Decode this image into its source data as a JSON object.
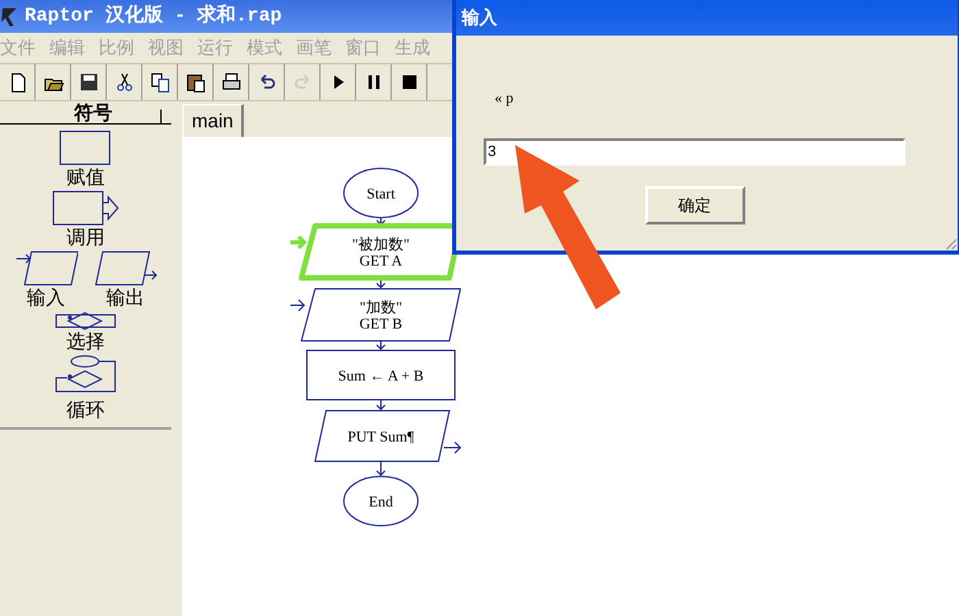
{
  "window": {
    "title": "Raptor 汉化版 - 求和.rap"
  },
  "menu": [
    "文件",
    "编辑",
    "比例",
    "视图",
    "运行",
    "模式",
    "画笔",
    "窗口",
    "生成"
  ],
  "toolbar": [
    {
      "kind": "new",
      "disabled": false
    },
    {
      "kind": "open",
      "disabled": false
    },
    {
      "kind": "save",
      "disabled": false
    },
    {
      "kind": "cut",
      "disabled": false
    },
    {
      "kind": "copy",
      "disabled": false
    },
    {
      "kind": "paste",
      "disabled": false
    },
    {
      "kind": "print",
      "disabled": false
    },
    {
      "kind": "undo",
      "disabled": false
    },
    {
      "kind": "redo",
      "disabled": true
    },
    {
      "kind": "run",
      "disabled": false
    },
    {
      "kind": "pause",
      "disabled": false
    },
    {
      "kind": "stop",
      "disabled": false
    }
  ],
  "palette": {
    "title": "符号",
    "items": [
      {
        "kind": "assign",
        "label": "赋值"
      },
      {
        "kind": "call",
        "label": "调用"
      },
      {
        "kind": "input",
        "label": "输入"
      },
      {
        "kind": "output",
        "label": "输出"
      },
      {
        "kind": "selection",
        "label": "选择"
      },
      {
        "kind": "loop",
        "label": "循环"
      }
    ]
  },
  "tabs": [
    {
      "label": "main",
      "selected": true
    }
  ],
  "flowchart": [
    {
      "kind": "terminal",
      "lines": [
        "Start"
      ],
      "selected": false
    },
    {
      "kind": "input",
      "lines": [
        "\"被加数\"",
        "GET A"
      ],
      "selected": true
    },
    {
      "kind": "input",
      "lines": [
        "\"加数\"",
        "GET B"
      ],
      "selected": false
    },
    {
      "kind": "assign",
      "lines": [
        "Sum ← A + B"
      ],
      "selected": false
    },
    {
      "kind": "output",
      "lines": [
        "PUT Sum¶"
      ],
      "selected": false
    },
    {
      "kind": "terminal",
      "lines": [
        "End"
      ],
      "selected": false
    }
  ],
  "dialog": {
    "title": "输入",
    "prompt": "« p",
    "value": "3",
    "button": "确定"
  }
}
